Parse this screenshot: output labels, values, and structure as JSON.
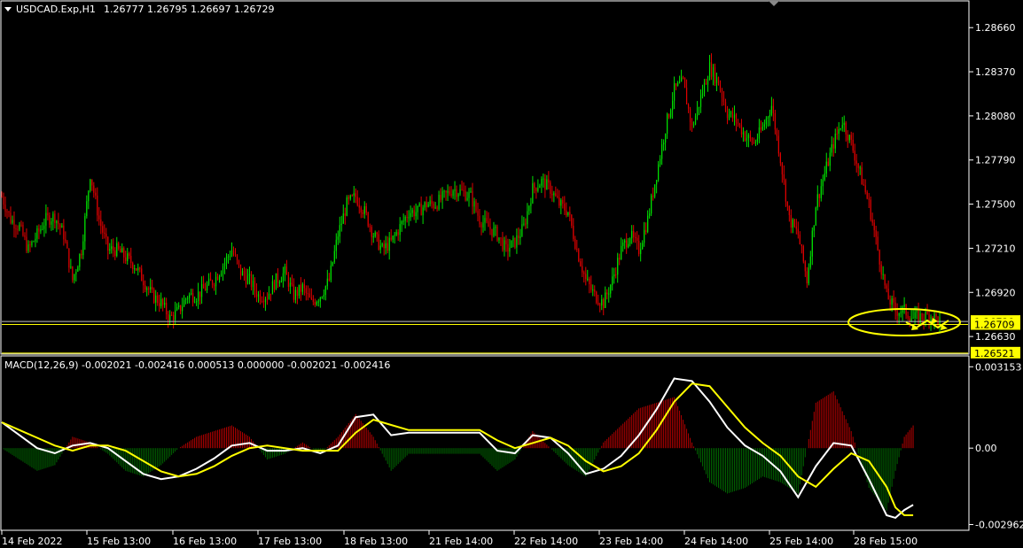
{
  "header": {
    "symbol_label": "USDCAD.Exp,H1",
    "ohlc": "1.26777 1.26795 1.26697 1.26729"
  },
  "macd_header": {
    "label": "MACD(12,26,9) -0.002021 -0.002416 0.000513 0.000000 -0.002021 -0.002416"
  },
  "colors": {
    "background": "#000000",
    "bull_candle": "#00e000",
    "bear_candle": "#e00000",
    "macd_line": "#ffffff",
    "signal_line": "#ffff00",
    "hist_pos": "#b00000",
    "hist_neg": "#006400",
    "grid_border": "#ffffff",
    "price_tag": "#ffff00"
  },
  "chart_data": [
    {
      "type": "candlestick",
      "title": "USDCAD.Exp,H1",
      "ylim": [
        1.2652,
        1.2883
      ],
      "y_ticks": [
        "1.28660",
        "1.28370",
        "1.28080",
        "1.27790",
        "1.27500",
        "1.27210",
        "1.26920",
        "1.26630"
      ],
      "x_ticks": [
        "14 Feb 2022",
        "15 Feb 13:00",
        "16 Feb 13:00",
        "17 Feb 13:00",
        "18 Feb 13:00",
        "21 Feb 14:00",
        "22 Feb 14:00",
        "23 Feb 14:00",
        "24 Feb 14:00",
        "25 Feb 14:00",
        "28 Feb 15:00"
      ],
      "price_tags": [
        "1.26729",
        "1.26709",
        "1.26521"
      ],
      "horizontal_levels": [
        1.26709,
        1.26729,
        1.26521
      ],
      "close_path": [
        [
          0,
          1.2755
        ],
        [
          5,
          1.274
        ],
        [
          10,
          1.2735
        ],
        [
          15,
          1.272
        ],
        [
          20,
          1.273
        ],
        [
          25,
          1.274
        ],
        [
          30,
          1.2742
        ],
        [
          35,
          1.273
        ],
        [
          40,
          1.27
        ],
        [
          45,
          1.272
        ],
        [
          50,
          1.277
        ],
        [
          55,
          1.274
        ],
        [
          60,
          1.272
        ],
        [
          65,
          1.272
        ],
        [
          70,
          1.2715
        ],
        [
          75,
          1.271
        ],
        [
          80,
          1.27
        ],
        [
          85,
          1.269
        ],
        [
          90,
          1.2685
        ],
        [
          95,
          1.2675
        ],
        [
          100,
          1.268
        ],
        [
          105,
          1.269
        ],
        [
          110,
          1.269
        ],
        [
          115,
          1.2695
        ],
        [
          120,
          1.27
        ],
        [
          125,
          1.271
        ],
        [
          130,
          1.272
        ],
        [
          135,
          1.2705
        ],
        [
          140,
          1.27
        ],
        [
          145,
          1.269
        ],
        [
          150,
          1.269
        ],
        [
          155,
          1.27
        ],
        [
          160,
          1.2705
        ],
        [
          165,
          1.269
        ],
        [
          170,
          1.2695
        ],
        [
          175,
          1.2685
        ],
        [
          180,
          1.269
        ],
        [
          185,
          1.27
        ],
        [
          190,
          1.273
        ],
        [
          195,
          1.275
        ],
        [
          200,
          1.2755
        ],
        [
          205,
          1.2745
        ],
        [
          210,
          1.273
        ],
        [
          215,
          1.272
        ],
        [
          220,
          1.2725
        ],
        [
          225,
          1.2735
        ],
        [
          230,
          1.2745
        ],
        [
          235,
          1.2745
        ],
        [
          240,
          1.275
        ],
        [
          245,
          1.275
        ],
        [
          250,
          1.2755
        ],
        [
          255,
          1.276
        ],
        [
          260,
          1.2758
        ],
        [
          265,
          1.2755
        ],
        [
          270,
          1.274
        ],
        [
          275,
          1.2735
        ],
        [
          280,
          1.273
        ],
        [
          285,
          1.272
        ],
        [
          290,
          1.2725
        ],
        [
          295,
          1.2735
        ],
        [
          300,
          1.276
        ],
        [
          305,
          1.2765
        ],
        [
          310,
          1.276
        ],
        [
          315,
          1.275
        ],
        [
          320,
          1.2745
        ],
        [
          325,
          1.272
        ],
        [
          330,
          1.27
        ],
        [
          335,
          1.269
        ],
        [
          340,
          1.2685
        ],
        [
          345,
          1.27
        ],
        [
          350,
          1.272
        ],
        [
          355,
          1.273
        ],
        [
          360,
          1.272
        ],
        [
          365,
          1.274
        ],
        [
          370,
          1.277
        ],
        [
          375,
          1.28
        ],
        [
          380,
          1.2825
        ],
        [
          385,
          1.283
        ],
        [
          390,
          1.28
        ],
        [
          395,
          1.282
        ],
        [
          400,
          1.284
        ],
        [
          405,
          1.283
        ],
        [
          410,
          1.281
        ],
        [
          415,
          1.2805
        ],
        [
          420,
          1.2795
        ],
        [
          425,
          1.279
        ],
        [
          430,
          1.28
        ],
        [
          435,
          1.2815
        ],
        [
          440,
          1.278
        ],
        [
          445,
          1.274
        ],
        [
          450,
          1.273
        ],
        [
          455,
          1.27
        ],
        [
          460,
          1.275
        ],
        [
          465,
          1.277
        ],
        [
          470,
          1.279
        ],
        [
          475,
          1.2805
        ],
        [
          480,
          1.279
        ],
        [
          485,
          1.277
        ],
        [
          490,
          1.275
        ],
        [
          495,
          1.272
        ],
        [
          500,
          1.269
        ],
        [
          505,
          1.268
        ],
        [
          510,
          1.268
        ],
        [
          515,
          1.2675
        ],
        [
          520,
          1.2676
        ],
        [
          525,
          1.2677
        ],
        [
          530,
          1.2673
        ]
      ]
    },
    {
      "type": "macd",
      "title": "MACD(12,26,9)",
      "ylim": [
        -0.00315,
        0.0033
      ],
      "y_ticks": [
        "0.003153",
        "0.00",
        "-0.002962"
      ],
      "macd": [
        [
          0,
          0.001
        ],
        [
          10,
          0.0005
        ],
        [
          20,
          0.0
        ],
        [
          30,
          -0.0002
        ],
        [
          40,
          0.0001
        ],
        [
          50,
          0.0002
        ],
        [
          60,
          0.0
        ],
        [
          70,
          -0.0005
        ],
        [
          80,
          -0.001
        ],
        [
          90,
          -0.0012
        ],
        [
          100,
          -0.0011
        ],
        [
          110,
          -0.0008
        ],
        [
          120,
          -0.0004
        ],
        [
          130,
          0.0001
        ],
        [
          140,
          0.0002
        ],
        [
          150,
          -0.0001
        ],
        [
          160,
          -0.0001
        ],
        [
          170,
          0.0
        ],
        [
          180,
          -0.0002
        ],
        [
          190,
          0.0001
        ],
        [
          200,
          0.0012
        ],
        [
          210,
          0.0013
        ],
        [
          220,
          0.0005
        ],
        [
          230,
          0.0006
        ],
        [
          240,
          0.0006
        ],
        [
          250,
          0.0006
        ],
        [
          260,
          0.0006
        ],
        [
          270,
          0.0006
        ],
        [
          280,
          -0.0001
        ],
        [
          290,
          -0.0002
        ],
        [
          300,
          0.0005
        ],
        [
          310,
          0.0004
        ],
        [
          320,
          -0.0002
        ],
        [
          330,
          -0.001
        ],
        [
          340,
          -0.0008
        ],
        [
          350,
          -0.0003
        ],
        [
          360,
          0.0005
        ],
        [
          370,
          0.0015
        ],
        [
          380,
          0.0027
        ],
        [
          390,
          0.0026
        ],
        [
          400,
          0.0018
        ],
        [
          410,
          0.0008
        ],
        [
          420,
          0.0001
        ],
        [
          430,
          -0.0003
        ],
        [
          440,
          -0.0009
        ],
        [
          450,
          -0.0019
        ],
        [
          460,
          -0.0007
        ],
        [
          470,
          0.0002
        ],
        [
          480,
          0.0001
        ],
        [
          490,
          -0.0012
        ],
        [
          500,
          -0.0026
        ],
        [
          505,
          -0.0027
        ],
        [
          510,
          -0.0024
        ],
        [
          515,
          -0.0022
        ]
      ],
      "signal": [
        [
          0,
          0.001
        ],
        [
          10,
          0.0007
        ],
        [
          20,
          0.0004
        ],
        [
          30,
          0.0001
        ],
        [
          40,
          -0.0001
        ],
        [
          50,
          0.0001
        ],
        [
          60,
          0.0001
        ],
        [
          70,
          -0.0001
        ],
        [
          80,
          -0.0005
        ],
        [
          90,
          -0.0009
        ],
        [
          100,
          -0.0011
        ],
        [
          110,
          -0.001
        ],
        [
          120,
          -0.0007
        ],
        [
          130,
          -0.0003
        ],
        [
          140,
          0.0
        ],
        [
          150,
          0.0001
        ],
        [
          160,
          0.0
        ],
        [
          170,
          -0.0001
        ],
        [
          180,
          -0.0001
        ],
        [
          190,
          -0.0001
        ],
        [
          200,
          0.0006
        ],
        [
          210,
          0.0011
        ],
        [
          220,
          0.0009
        ],
        [
          230,
          0.0007
        ],
        [
          240,
          0.0007
        ],
        [
          250,
          0.0007
        ],
        [
          260,
          0.0007
        ],
        [
          270,
          0.0007
        ],
        [
          280,
          0.0003
        ],
        [
          290,
          0.0
        ],
        [
          300,
          0.0002
        ],
        [
          310,
          0.0004
        ],
        [
          320,
          0.0001
        ],
        [
          330,
          -0.0005
        ],
        [
          340,
          -0.0009
        ],
        [
          350,
          -0.0007
        ],
        [
          360,
          -0.0002
        ],
        [
          370,
          0.0007
        ],
        [
          380,
          0.0018
        ],
        [
          390,
          0.0025
        ],
        [
          400,
          0.0024
        ],
        [
          410,
          0.0016
        ],
        [
          420,
          0.0008
        ],
        [
          430,
          0.0002
        ],
        [
          440,
          -0.0003
        ],
        [
          450,
          -0.0011
        ],
        [
          460,
          -0.0015
        ],
        [
          470,
          -0.0008
        ],
        [
          480,
          -0.0002
        ],
        [
          490,
          -0.0005
        ],
        [
          500,
          -0.0015
        ],
        [
          505,
          -0.0023
        ],
        [
          510,
          -0.0026
        ],
        [
          515,
          -0.0026
        ]
      ]
    }
  ]
}
